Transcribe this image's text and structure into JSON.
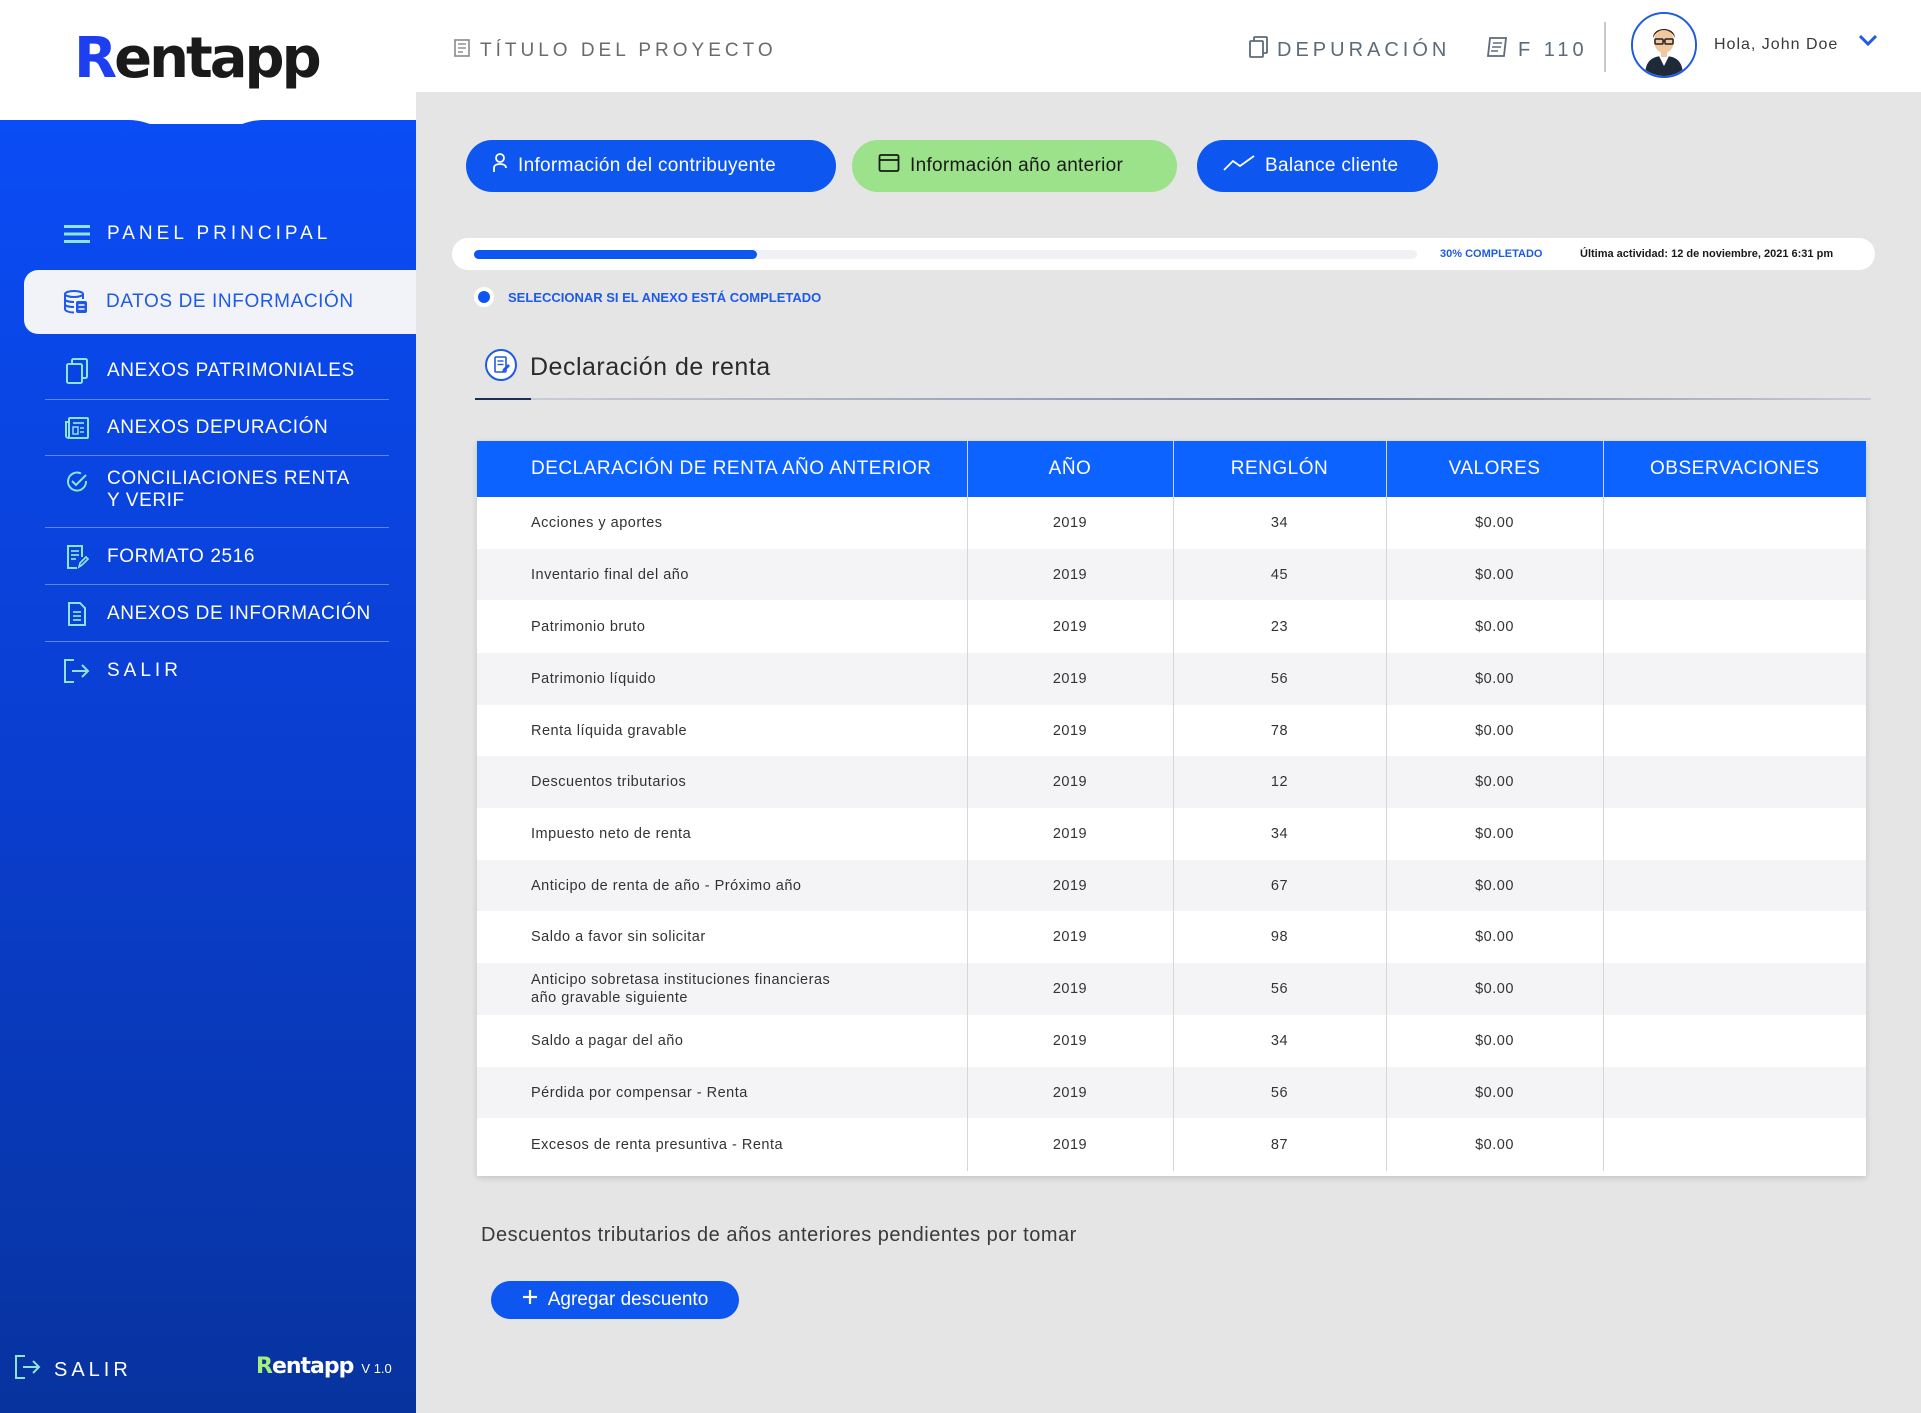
{
  "app": {
    "logo_r": "R",
    "logo_rest": "entapp",
    "project_title": "TÍTULO DEL PROYECTO"
  },
  "header": {
    "depuracion": "DEPURACIÓN",
    "f110": "F 110",
    "greeting": "Hola, John Doe"
  },
  "sidebar": {
    "items": [
      {
        "label": "PANEL PRINCIPAL",
        "icon": "hamburger-icon"
      },
      {
        "label": "DATOS DE INFORMACIÓN",
        "icon": "database-icon"
      },
      {
        "label": "ANEXOS PATRIMONIALES",
        "icon": "copy-icon"
      },
      {
        "label": "ANEXOS DEPURACIÓN",
        "icon": "newspaper-icon"
      },
      {
        "label": "CONCILIACIONES RENTA",
        "label2": "Y VERIF",
        "icon": "check-circle-icon"
      },
      {
        "label": "FORMATO 2516",
        "icon": "form-edit-icon"
      },
      {
        "label": "ANEXOS DE INFORMACIÓN",
        "icon": "document-icon"
      },
      {
        "label": "SALIR",
        "icon": "logout-icon"
      }
    ],
    "footer_salir": "SALIR",
    "footer_logo_r": "R",
    "footer_logo_rest": "entapp",
    "version": "V 1.0"
  },
  "tabs": [
    {
      "label": "Información del contribuyente",
      "icon": "user-icon"
    },
    {
      "label": "Información año anterior",
      "icon": "calendar-icon"
    },
    {
      "label": "Balance cliente",
      "icon": "trend-icon"
    }
  ],
  "progress": {
    "percent": 30,
    "label": "30% COMPLETADO",
    "last_activity": "Última actividad: 12 de noviembre, 2021 6:31 pm"
  },
  "complete_check_label": "SELECCIONAR SI EL ANEXO ESTÁ COMPLETADO",
  "section": {
    "title": "Declaración de renta"
  },
  "table": {
    "headers": [
      "DECLARACIÓN DE RENTA AÑO ANTERIOR",
      "AÑO",
      "RENGLÓN",
      "VALORES",
      "OBSERVACIONES"
    ],
    "rows": [
      {
        "concept": "Acciones y aportes",
        "year": "2019",
        "line": "34",
        "value": "$0.00",
        "obs": ""
      },
      {
        "concept": "Inventario final del año",
        "year": "2019",
        "line": "45",
        "value": "$0.00",
        "obs": ""
      },
      {
        "concept": "Patrimonio bruto",
        "year": "2019",
        "line": "23",
        "value": "$0.00",
        "obs": ""
      },
      {
        "concept": "Patrimonio líquido",
        "year": "2019",
        "line": "56",
        "value": "$0.00",
        "obs": ""
      },
      {
        "concept": "Renta líquida gravable",
        "year": "2019",
        "line": "78",
        "value": "$0.00",
        "obs": ""
      },
      {
        "concept": "Descuentos tributarios",
        "year": "2019",
        "line": "12",
        "value": "$0.00",
        "obs": ""
      },
      {
        "concept": "Impuesto neto de renta",
        "year": "2019",
        "line": "34",
        "value": "$0.00",
        "obs": ""
      },
      {
        "concept": "Anticipo de renta de año - Próximo año",
        "year": "2019",
        "line": "67",
        "value": "$0.00",
        "obs": ""
      },
      {
        "concept": "Saldo a favor sin solicitar",
        "year": "2019",
        "line": "98",
        "value": "$0.00",
        "obs": ""
      },
      {
        "concept": "Anticipo sobretasa instituciones financieras",
        "concept2": "año gravable siguiente",
        "year": "2019",
        "line": "56",
        "value": "$0.00",
        "obs": ""
      },
      {
        "concept": "Saldo a pagar del año",
        "year": "2019",
        "line": "34",
        "value": "$0.00",
        "obs": ""
      },
      {
        "concept": "Pérdida por compensar - Renta",
        "year": "2019",
        "line": "56",
        "value": "$0.00",
        "obs": ""
      },
      {
        "concept": "Excesos de renta presuntiva - Renta",
        "year": "2019",
        "line": "87",
        "value": "$0.00",
        "obs": ""
      }
    ]
  },
  "pending": {
    "title": "Descuentos tributarios de años anteriores pendientes por tomar",
    "add_button": "Agregar descuento"
  },
  "colors": {
    "primary": "#0d57f0",
    "accent_green": "#9be28a",
    "background": "#e5e5e5"
  }
}
